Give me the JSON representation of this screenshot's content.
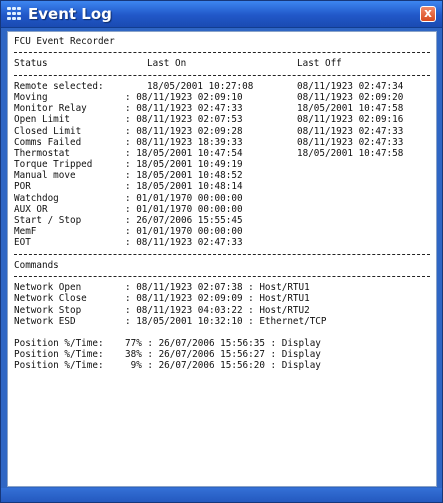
{
  "window": {
    "title": "Event Log",
    "close_glyph": "x"
  },
  "log": {
    "recorder_title": "FCU Event Recorder",
    "status_header": {
      "status": "Status",
      "last_on": "Last On",
      "last_off": "Last Off"
    },
    "status_rows": [
      {
        "name": "Remote selected:",
        "on": "18/05/2001 10:27:08",
        "off": "08/11/1923 02:47:34"
      },
      {
        "name": "Moving",
        "on": ": 08/11/1923 02:09:10",
        "off": "08/11/1923 02:09:20"
      },
      {
        "name": "Monitor Relay",
        "on": ": 08/11/1923 02:47:33",
        "off": "18/05/2001 10:47:58"
      },
      {
        "name": "Open Limit",
        "on": ": 08/11/1923 02:07:53",
        "off": "08/11/1923 02:09:16"
      },
      {
        "name": "Closed Limit",
        "on": ": 08/11/1923 02:09:28",
        "off": "08/11/1923 02:47:33"
      },
      {
        "name": "Comms Failed",
        "on": ": 08/11/1923 18:39:33",
        "off": "08/11/1923 02:47:33"
      },
      {
        "name": "Thermostat",
        "on": ": 18/05/2001 10:47:54",
        "off": "18/05/2001 10:47:58"
      },
      {
        "name": "Torque Tripped",
        "on": ": 18/05/2001 10:49:19",
        "off": ""
      },
      {
        "name": "Manual move",
        "on": ": 18/05/2001 10:48:52",
        "off": ""
      },
      {
        "name": "POR",
        "on": ": 18/05/2001 10:48:14",
        "off": ""
      },
      {
        "name": "Watchdog",
        "on": ": 01/01/1970 00:00:00",
        "off": ""
      },
      {
        "name": "AUX OR",
        "on": ": 01/01/1970 00:00:00",
        "off": ""
      },
      {
        "name": "Start / Stop",
        "on": ": 26/07/2006 15:55:45",
        "off": ""
      },
      {
        "name": "MemF",
        "on": ": 01/01/1970 00:00:00",
        "off": ""
      },
      {
        "name": "EOT",
        "on": ": 08/11/1923 02:47:33",
        "off": ""
      }
    ],
    "commands_header": "Commands",
    "command_rows": [
      {
        "name": "Network Open",
        "detail": ": 08/11/1923 02:07:38 : Host/RTU1"
      },
      {
        "name": "Network Close",
        "detail": ": 08/11/1923 02:09:09 : Host/RTU1"
      },
      {
        "name": "Network Stop",
        "detail": ": 08/11/1923 04:03:22 : Host/RTU2"
      },
      {
        "name": "Network ESD",
        "detail": ": 18/05/2001 10:32:10 : Ethernet/TCP"
      }
    ],
    "position_rows": [
      {
        "name": "Position %/Time:",
        "detail": "77% : 26/07/2006 15:56:35 : Display"
      },
      {
        "name": "Position %/Time:",
        "detail": "38% : 26/07/2006 15:56:27 : Display"
      },
      {
        "name": "Position %/Time:",
        "detail": " 9% : 26/07/2006 15:56:20 : Display"
      }
    ]
  }
}
